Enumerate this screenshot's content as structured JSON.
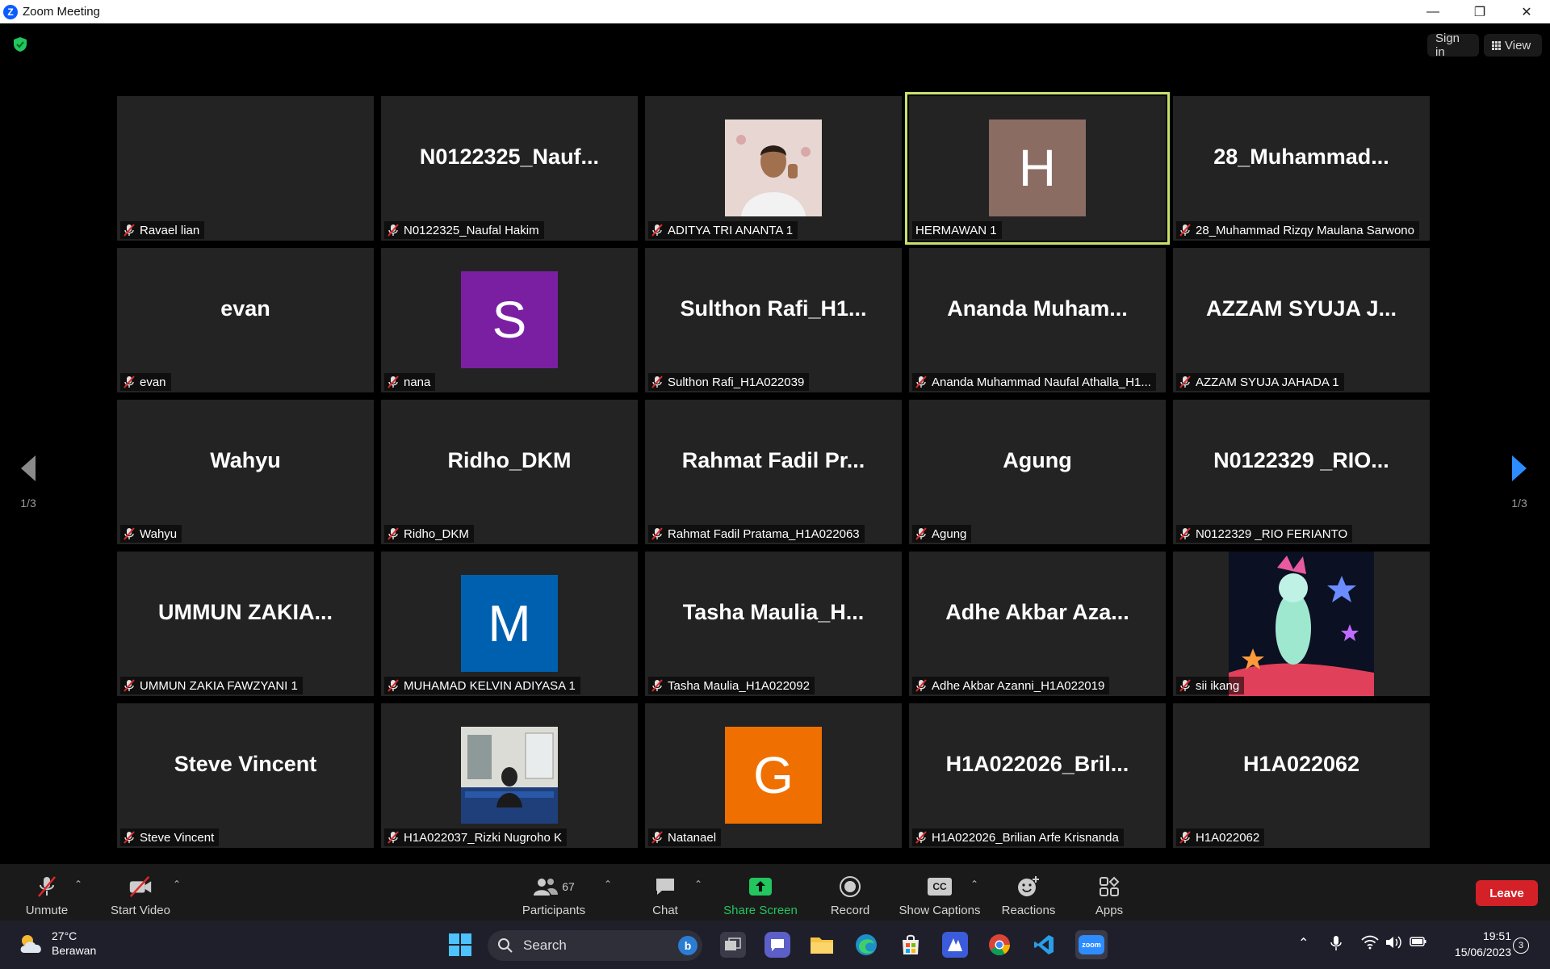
{
  "window": {
    "title": "Zoom Meeting",
    "logo_letter": "Z"
  },
  "top": {
    "signin_label": "Sign in",
    "view_label": "View"
  },
  "pager": {
    "left": "1/3",
    "right": "1/3"
  },
  "tiles": [
    {
      "big": "",
      "label": "Ravael lian"
    },
    {
      "big": "N0122325_Nauf...",
      "label": "N0122325_Naufal Hakim"
    },
    {
      "big": "",
      "label": "ADITYA TRI ANANTA 1",
      "photo": "boy"
    },
    {
      "big": "",
      "label": "HERMAWAN 1",
      "avatar": "H",
      "avatar_color": "#8a6c62",
      "active": true,
      "muted": false
    },
    {
      "big": "28_Muhammad...",
      "label": "28_Muhammad Rizqy Maulana Sarwono"
    },
    {
      "big": "evan",
      "label": "evan"
    },
    {
      "big": "",
      "label": "nana",
      "avatar": "S",
      "avatar_color": "#7b1fa2"
    },
    {
      "big": "Sulthon Rafi_H1...",
      "label": "Sulthon Rafi_H1A022039"
    },
    {
      "big": "Ananda Muham...",
      "label": "Ananda Muhammad Naufal Athalla_H1..."
    },
    {
      "big": "AZZAM SYUJA J...",
      "label": "AZZAM SYUJA JAHADA 1"
    },
    {
      "big": "Wahyu",
      "label": "Wahyu"
    },
    {
      "big": "Ridho_DKM",
      "label": "Ridho_DKM"
    },
    {
      "big": "Rahmat Fadil Pr...",
      "label": "Rahmat Fadil Pratama_H1A022063"
    },
    {
      "big": "Agung",
      "label": "Agung"
    },
    {
      "big": "N0122329 _RIO...",
      "label": "N0122329 _RIO FERIANTO"
    },
    {
      "big": "UMMUN ZAKIA...",
      "label": "UMMUN ZAKIA FAWZYANI 1"
    },
    {
      "big": "",
      "label": "MUHAMAD KELVIN ADIYASA 1",
      "avatar": "M",
      "avatar_color": "#0060b0"
    },
    {
      "big": "Tasha Maulia_H...",
      "label": "Tasha Maulia_H1A022092"
    },
    {
      "big": "Adhe Akbar Aza...",
      "label": "Adhe Akbar Azanni_H1A022019"
    },
    {
      "big": "",
      "label": "sii ikang",
      "photo": "art"
    },
    {
      "big": "Steve Vincent",
      "label": "Steve Vincent"
    },
    {
      "big": "",
      "label": "H1A022037_Rizki Nugroho K",
      "photo": "room"
    },
    {
      "big": "",
      "label": "Natanael",
      "avatar": "G",
      "avatar_color": "#ef7000"
    },
    {
      "big": "H1A022026_Bril...",
      "label": "H1A022026_Brilian Arfe Krisnanda"
    },
    {
      "big": "H1A022062",
      "label": "H1A022062"
    }
  ],
  "toolbar": {
    "unmute": "Unmute",
    "start_video": "Start Video",
    "participants": "Participants",
    "participants_count": "67",
    "chat": "Chat",
    "share_screen": "Share Screen",
    "record": "Record",
    "captions": "Show Captions",
    "captions_icon": "CC",
    "reactions": "Reactions",
    "apps": "Apps",
    "leave": "Leave"
  },
  "taskbar": {
    "temperature": "27°C",
    "weather": "Berawan",
    "search_placeholder": "Search",
    "time": "19:51",
    "date": "15/06/2023",
    "notifications": "3"
  }
}
